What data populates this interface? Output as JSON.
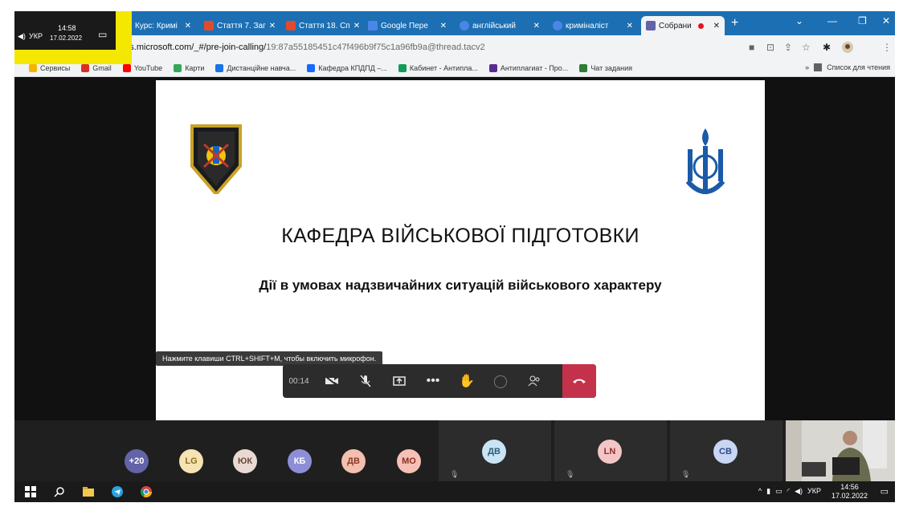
{
  "browser": {
    "tabs": [
      {
        "label": "Курс: Кримі",
        "color": "#5b8bd0"
      },
      {
        "label": "Стаття 7. Заг",
        "color": "#e04b2d"
      },
      {
        "label": "Стаття 18. Сп",
        "color": "#e04b2d"
      },
      {
        "label": "Google Пере",
        "color": "#4a86e8"
      },
      {
        "label": "англійський",
        "color": "#4a86e8"
      },
      {
        "label": "криміналіст",
        "color": "#4a86e8"
      },
      {
        "label": "Собрани",
        "color": "#6264a7"
      }
    ],
    "url_host": "ams.microsoft.com/_#/pre-join-calling/",
    "url_rest": "19:87a55185451c47f496b9f75c1a96fb9a@thread.tacv2",
    "bookmarks": [
      {
        "label": "Сервисы",
        "color": "#f4b400"
      },
      {
        "label": "Gmail",
        "color": "#d93025"
      },
      {
        "label": "YouTube",
        "color": "#ff0000"
      },
      {
        "label": "Карти",
        "color": "#34a853"
      },
      {
        "label": "Дистанційне навча...",
        "color": "#1a73e8"
      },
      {
        "label": "Кафедра КПДПД –...",
        "color": "#1769ff"
      },
      {
        "label": "Кабинет - Антипла...",
        "color": "#0f9d58"
      },
      {
        "label": "Антиплагиат - Про...",
        "color": "#5b2c8f"
      },
      {
        "label": "Чат задания",
        "color": "#2e7d32"
      }
    ],
    "reading_list": "Список для чтения"
  },
  "slide": {
    "title": "КАФЕДРА ВІЙСЬКОВОЇ ПІДГОТОВКИ",
    "subtitle": "Дії в умовах надзвичайних ситуацій військового характеру"
  },
  "call": {
    "tip": "Нажмите клавиши CTRL+SHIFT+M, чтобы включить микрофон.",
    "timer": "00:14"
  },
  "participants": {
    "avatars": [
      {
        "initials": "+20",
        "color": "#6264a7",
        "text": "#ffffff"
      },
      {
        "initials": "LG",
        "color": "#f6e3b4",
        "text": "#8a6d1f"
      },
      {
        "initials": "ЮК",
        "color": "#ead9d3",
        "text": "#6b4a40"
      },
      {
        "initials": "КБ",
        "color": "#8d8fd6",
        "text": "#ffffff"
      },
      {
        "initials": "ДВ",
        "color": "#f3bfae",
        "text": "#8a3b26"
      },
      {
        "initials": "МО",
        "color": "#f7c0b6",
        "text": "#8a2f23"
      }
    ],
    "tiles": [
      {
        "initials": "ДВ",
        "color": "#c9e5f5",
        "text": "#2b5c7c"
      },
      {
        "initials": "LN",
        "color": "#f3c6c6",
        "text": "#8f2d2d"
      },
      {
        "initials": "СВ",
        "color": "#c9d6f3",
        "text": "#2b4a8a"
      }
    ]
  },
  "taskbar": {
    "lang": "УКР",
    "time": "14:56",
    "date": "17.02.2022"
  },
  "overlay": {
    "lang": "УКР",
    "time": "14:58",
    "date": "17.02.2022"
  }
}
